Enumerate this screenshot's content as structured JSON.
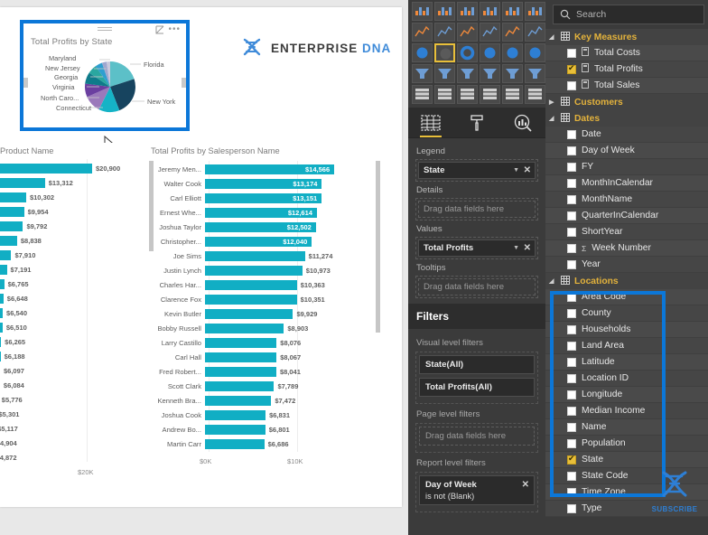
{
  "brand": {
    "logo_text_1": "ENTERPRISE",
    "logo_text_2": "DNA",
    "logo_icon": "dna-helix-icon"
  },
  "watermark": {
    "label": "SUBSCRIBE",
    "icon": "dna-helix-icon"
  },
  "pie_visual": {
    "title": "Total Profits by State",
    "header_icons": [
      "drag-handle-icon",
      "focus-mode-icon",
      "more-options-icon"
    ]
  },
  "left_chart": {
    "title": "Product Name",
    "axis_label": "$20K"
  },
  "right_chart": {
    "title": "Total Profits by Salesperson Name",
    "axis_labels": [
      "$0K",
      "$10K"
    ]
  },
  "visualizations": {
    "tabs": [
      "fields-tab",
      "format-tab",
      "analytics-tab"
    ],
    "selected_visual": "pie-chart",
    "wells": [
      {
        "label": "Legend",
        "value": "State",
        "empty": false
      },
      {
        "label": "Details",
        "value": "Drag data fields here",
        "empty": true
      },
      {
        "label": "Values",
        "value": "Total Profits",
        "empty": false
      },
      {
        "label": "Tooltips",
        "value": "Drag data fields here",
        "empty": true
      }
    ]
  },
  "filters": {
    "header": "Filters",
    "sections": [
      {
        "label": "Visual level filters",
        "items": [
          {
            "text": "State(All)",
            "empty": false
          },
          {
            "text": "Total Profits(All)",
            "empty": false
          }
        ]
      },
      {
        "label": "Page level filters",
        "items": [
          {
            "text": "Drag data fields here",
            "empty": true
          }
        ]
      },
      {
        "label": "Report level filters",
        "items": [
          {
            "text": "Day of Week",
            "sub": "is not (Blank)",
            "empty": false
          }
        ]
      }
    ]
  },
  "fields": {
    "search_placeholder": "Search",
    "search_icon": "search-icon",
    "tables": [
      {
        "name": "Key Measures",
        "expanded": true,
        "icon": "measure-table-icon",
        "items": [
          {
            "label": "Total Costs",
            "checked": false,
            "measure": true
          },
          {
            "label": "Total Profits",
            "checked": true,
            "measure": true
          },
          {
            "label": "Total Sales",
            "checked": false,
            "measure": true
          }
        ]
      },
      {
        "name": "Customers",
        "expanded": false,
        "icon": "table-icon",
        "items": []
      },
      {
        "name": "Dates",
        "expanded": true,
        "icon": "table-icon",
        "items": [
          {
            "label": "Date",
            "checked": false
          },
          {
            "label": "Day of Week",
            "checked": false
          },
          {
            "label": "FY",
            "checked": false
          },
          {
            "label": "MonthInCalendar",
            "checked": false
          },
          {
            "label": "MonthName",
            "checked": false
          },
          {
            "label": "QuarterInCalendar",
            "checked": false
          },
          {
            "label": "ShortYear",
            "checked": false
          },
          {
            "label": "Week Number",
            "checked": false,
            "sigma": true
          },
          {
            "label": "Year",
            "checked": false
          }
        ]
      },
      {
        "name": "Locations",
        "expanded": true,
        "icon": "table-icon",
        "highlighted": true,
        "items": [
          {
            "label": "Area Code",
            "checked": false
          },
          {
            "label": "County",
            "checked": false
          },
          {
            "label": "Households",
            "checked": false
          },
          {
            "label": "Land Area",
            "checked": false
          },
          {
            "label": "Latitude",
            "checked": false
          },
          {
            "label": "Location ID",
            "checked": false
          },
          {
            "label": "Longitude",
            "checked": false
          },
          {
            "label": "Median Income",
            "checked": false
          },
          {
            "label": "Name",
            "checked": false
          },
          {
            "label": "Population",
            "checked": false
          },
          {
            "label": "State",
            "checked": true
          },
          {
            "label": "State Code",
            "checked": false
          },
          {
            "label": "Time Zone",
            "checked": false
          },
          {
            "label": "Type",
            "checked": false
          }
        ]
      }
    ]
  },
  "chart_data": [
    {
      "type": "pie",
      "title": "Total Profits by State",
      "labels": [
        "Florida",
        "New York",
        "Connecticut",
        "North Caro...",
        "Virginia",
        "Georgia",
        "New Jersey",
        "Maryland"
      ],
      "values": [
        26,
        22,
        11,
        9,
        8,
        7,
        6,
        5,
        6
      ],
      "colors": [
        "#5cc0c8",
        "#17445f",
        "#15b3c6",
        "#8e6fab",
        "#6b3fa0",
        "#0f7b8a",
        "#2aa7a0",
        "#9fa7cf",
        "#c9c9dd"
      ],
      "legend": "State"
    },
    {
      "type": "bar",
      "orientation": "horizontal",
      "title": "Product Name",
      "xlabel": "",
      "ylabel": "",
      "axis_ticks": [
        "$20K"
      ],
      "categories": [
        "",
        "",
        "",
        "",
        "",
        "",
        "",
        "",
        "",
        "",
        "",
        "",
        "",
        "",
        "",
        "",
        "",
        "",
        "",
        ""
      ],
      "values": [
        20900,
        13312,
        10302,
        9954,
        9792,
        8838,
        7910,
        7191,
        6765,
        6648,
        6540,
        6510,
        6265,
        6188,
        6097,
        6084,
        5776,
        5301,
        5117,
        4904,
        4872
      ],
      "value_labels": [
        "$20,900",
        "$13,312",
        "$10,302",
        "$9,954",
        "$9,792",
        "$8,838",
        "$7,910",
        "$7,191",
        "$6,765",
        "$6,648",
        "$6,540",
        "$6,510",
        "$6,265",
        "$6,188",
        "$6,097",
        "$6,084",
        "$5,776",
        "$5,301",
        "$5,117",
        "$4,904",
        "$4,872"
      ],
      "color": "#11aec4"
    },
    {
      "type": "bar",
      "orientation": "horizontal",
      "title": "Total Profits by Salesperson Name",
      "xlabel": "",
      "ylabel": "",
      "axis_ticks": [
        "$0K",
        "$10K"
      ],
      "categories": [
        "Jeremy Men...",
        "Walter Cook",
        "Carl Elliott",
        "Ernest Whe...",
        "Joshua Taylor",
        "Christopher...",
        "Joe Sims",
        "Justin Lynch",
        "Charles Har...",
        "Clarence Fox",
        "Kevin Butler",
        "Bobby Russell",
        "Larry Castillo",
        "Carl Hall",
        "Fred Robert...",
        "Scott Clark",
        "Kenneth Bra...",
        "Joshua Cook",
        "Andrew Bo...",
        "Martin Carr"
      ],
      "values": [
        14566,
        13174,
        13151,
        12614,
        12502,
        12040,
        11274,
        10973,
        10363,
        10351,
        9929,
        8903,
        8076,
        8067,
        8041,
        7789,
        7472,
        6831,
        6801,
        6686
      ],
      "value_labels": [
        "$14,566",
        "$13,174",
        "$13,151",
        "$12,614",
        "$12,502",
        "$12,040",
        "$11,274",
        "$10,973",
        "$10,363",
        "$10,351",
        "$9,929",
        "$8,903",
        "$8,076",
        "$8,067",
        "$8,041",
        "$7,789",
        "$7,472",
        "$6,831",
        "$6,801",
        "$6,686"
      ],
      "labels_inside": [
        true,
        true,
        true,
        true,
        true,
        true,
        false,
        false,
        false,
        false,
        false,
        false,
        false,
        false,
        false,
        false,
        false,
        false,
        false,
        false
      ],
      "color": "#11aec4"
    }
  ]
}
